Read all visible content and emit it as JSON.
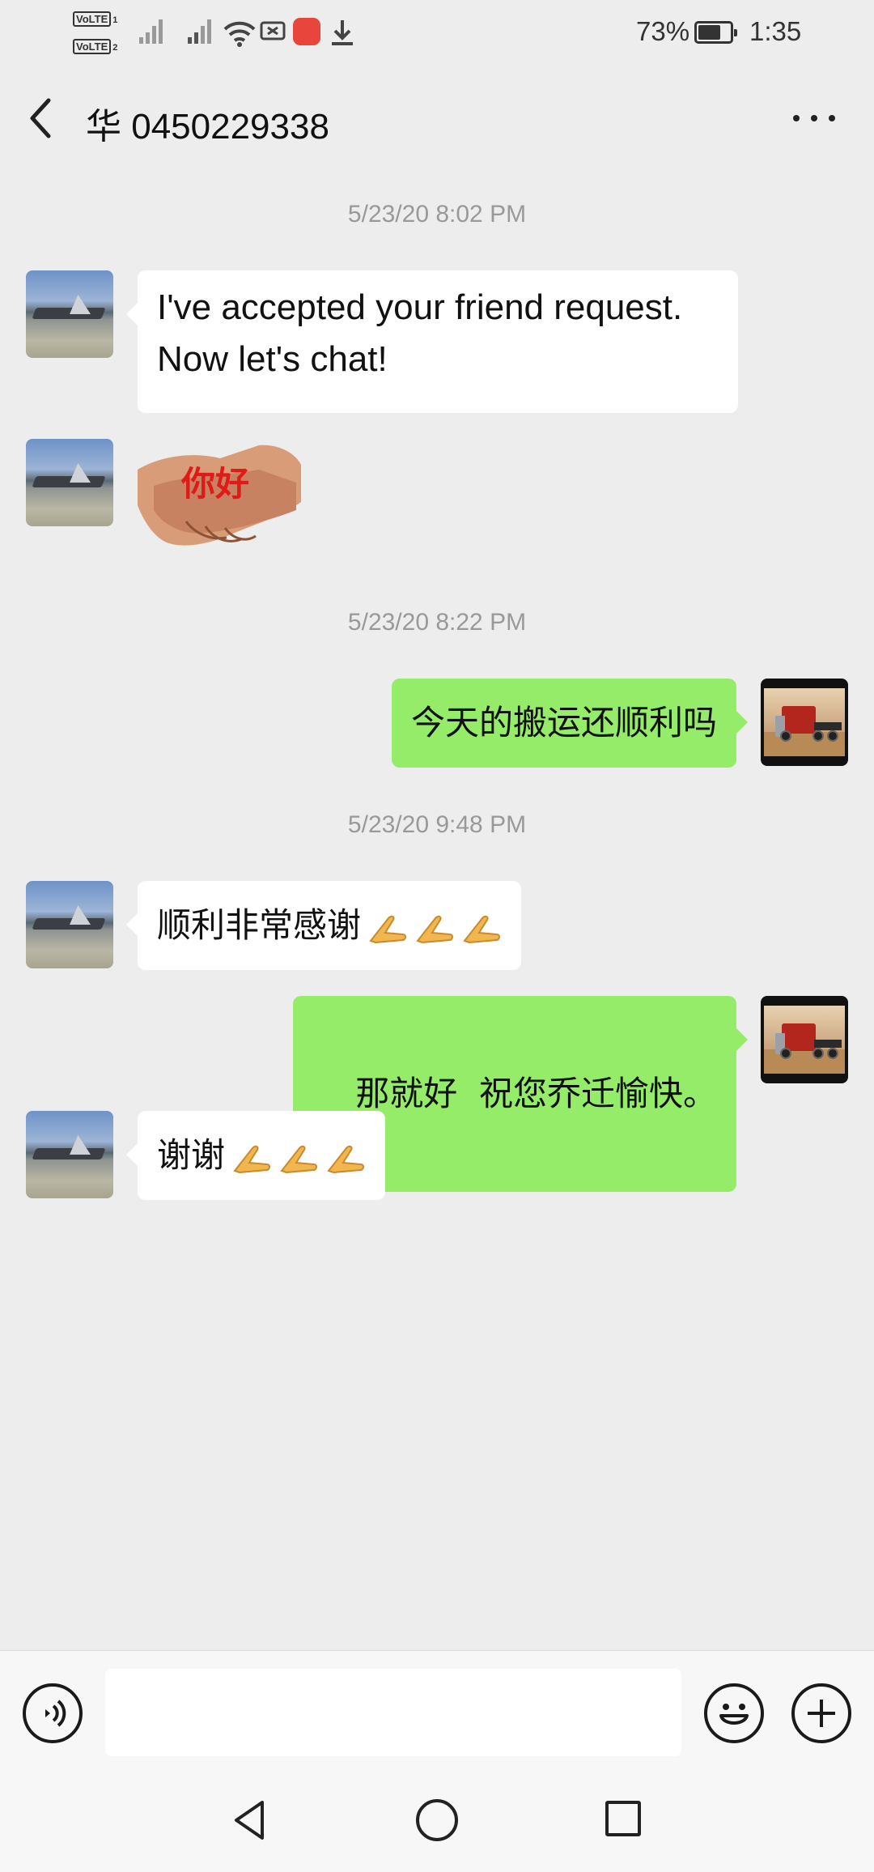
{
  "status_bar": {
    "volte1": "VoLTE",
    "volte1_sub": "1",
    "volte2": "VoLTE",
    "volte2_sub": "2",
    "battery_pct": "73%",
    "battery_level": 0.73,
    "time": "1:35"
  },
  "header": {
    "title": "华 0450229338"
  },
  "messages": [
    {
      "type": "timestamp",
      "text": "5/23/20 8:02 PM"
    },
    {
      "type": "incoming",
      "avatar": "jet-avatar",
      "line1": "I've accepted your friend request.",
      "line2": "Now let's chat!"
    },
    {
      "type": "incoming-sticker",
      "avatar": "jet-avatar",
      "sticker_text": "你好",
      "icon": "handshake-sticker"
    },
    {
      "type": "timestamp",
      "text": "5/23/20 8:22 PM"
    },
    {
      "type": "outgoing",
      "avatar": "truck-avatar",
      "text": "今天的搬运还顺利吗"
    },
    {
      "type": "timestamp",
      "text": "5/23/20 9:48 PM"
    },
    {
      "type": "incoming",
      "avatar": "jet-avatar",
      "text": "顺利非常感谢",
      "emoji": [
        "clap-emoji",
        "clap-emoji",
        "clap-emoji"
      ]
    },
    {
      "type": "outgoing",
      "avatar": "truck-avatar",
      "text": "那就好  祝您乔迁愉快。"
    },
    {
      "type": "incoming",
      "avatar": "jet-avatar",
      "text": "谢谢",
      "emoji": [
        "clap-emoji",
        "clap-emoji",
        "clap-emoji"
      ]
    }
  ],
  "input": {
    "value": "",
    "placeholder": ""
  },
  "icons": {
    "voice": "voice-input-icon",
    "emoji": "emoji-icon",
    "plus": "plus-icon",
    "back": "chevron-left-icon",
    "more": "more-dots-icon"
  },
  "colors": {
    "background": "#ededed",
    "outgoing_bubble": "#95ec69",
    "incoming_bubble": "#ffffff",
    "timestamp": "#999999"
  }
}
